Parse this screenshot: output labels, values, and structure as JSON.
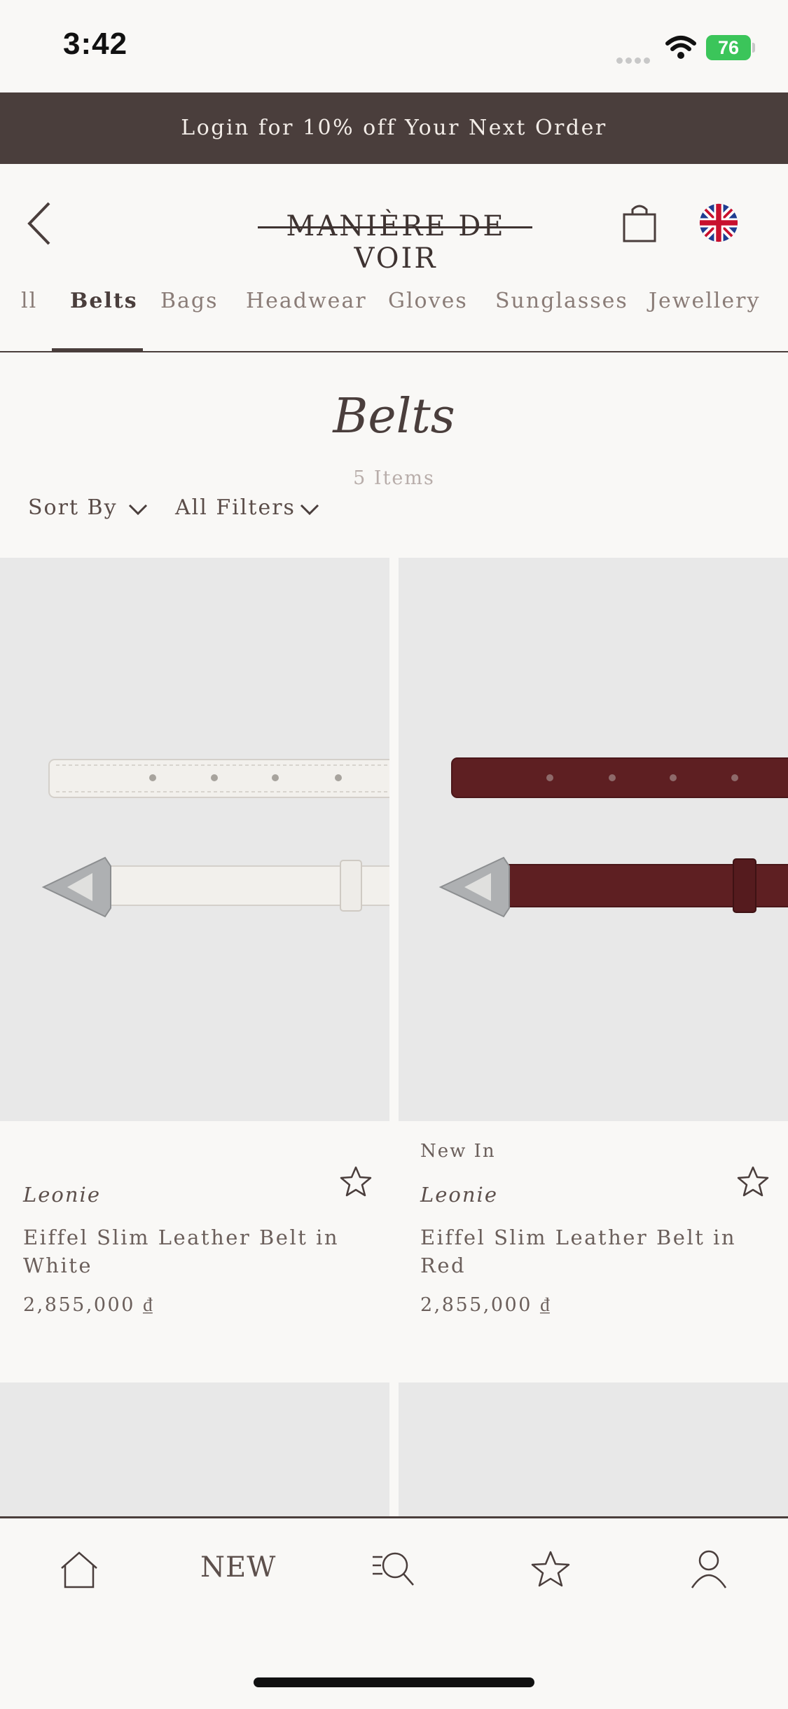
{
  "status_bar": {
    "time": "3:42",
    "battery": "76"
  },
  "promo": {
    "text": "Login for 10% off Your Next Order"
  },
  "header": {
    "logo": "MANIÈRE DE VOIR"
  },
  "tabs": [
    {
      "label": "ll"
    },
    {
      "label": "Belts",
      "active": true
    },
    {
      "label": "Bags"
    },
    {
      "label": "Headwear"
    },
    {
      "label": "Gloves"
    },
    {
      "label": "Sunglasses"
    },
    {
      "label": "Jewellery"
    }
  ],
  "page": {
    "title": "Belts",
    "item_count": "5 Items"
  },
  "filters": {
    "sort_label": "Sort By",
    "filters_label": "All Filters"
  },
  "products": [
    {
      "tag": "",
      "brand": "Leonie",
      "name": "Eiffel Slim Leather Belt in White",
      "price": "2,855,000 ₫",
      "color": "#f2f0ec"
    },
    {
      "tag": "New In",
      "brand": "Leonie",
      "name": "Eiffel Slim Leather Belt in Red",
      "price": "2,855,000 ₫",
      "color": "#5e1f22"
    }
  ],
  "bottom_nav": {
    "new_label": "NEW"
  },
  "colors": {
    "banner": "#4a3e3c",
    "background": "#f9f8f6",
    "text": "#4a3e3c"
  }
}
